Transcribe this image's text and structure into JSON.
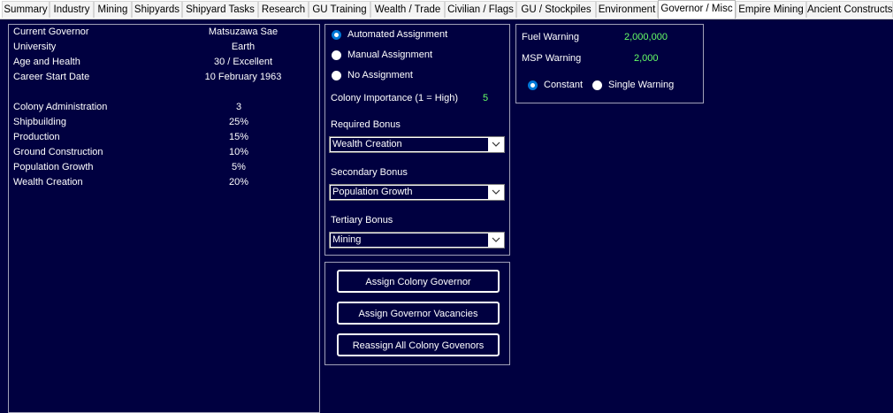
{
  "tabs": [
    {
      "label": "Summary"
    },
    {
      "label": "Industry"
    },
    {
      "label": "Mining"
    },
    {
      "label": "Shipyards"
    },
    {
      "label": "Shipyard Tasks"
    },
    {
      "label": "Research"
    },
    {
      "label": "GU Training"
    },
    {
      "label": "Wealth / Trade"
    },
    {
      "label": "Civilian / Flags"
    },
    {
      "label": "GU / Stockpiles"
    },
    {
      "label": "Environment"
    },
    {
      "label": "Governor / Misc"
    },
    {
      "label": "Empire Mining"
    },
    {
      "label": "Ancient Constructs"
    }
  ],
  "active_tab": "Governor / Misc",
  "governor": {
    "rows": [
      {
        "label": "Current Governor",
        "value": "Matsuzawa Sae"
      },
      {
        "label": "University",
        "value": "Earth"
      },
      {
        "label": "Age and Health",
        "value": "30 / Excellent"
      },
      {
        "label": "Career Start Date",
        "value": "10 February 1963"
      }
    ],
    "bonuses": [
      {
        "label": "Colony Administration",
        "value": "3"
      },
      {
        "label": "Shipbuilding",
        "value": "25%"
      },
      {
        "label": "Production",
        "value": "15%"
      },
      {
        "label": "Ground Construction",
        "value": "10%"
      },
      {
        "label": "Population Growth",
        "value": "5%"
      },
      {
        "label": "Wealth Creation",
        "value": "20%"
      }
    ]
  },
  "assignment": {
    "options": [
      {
        "label": "Automated Assignment",
        "selected": true
      },
      {
        "label": "Manual Assignment",
        "selected": false
      },
      {
        "label": "No Assignment",
        "selected": false
      }
    ],
    "importance_label": "Colony Importance (1 = High)",
    "importance_value": "5",
    "required_label": "Required Bonus",
    "required_value": "Wealth Creation",
    "secondary_label": "Secondary Bonus",
    "secondary_value": "Population Growth",
    "tertiary_label": "Tertiary Bonus",
    "tertiary_value": "Mining"
  },
  "buttons": {
    "assign_colony_governor": "Assign Colony Governor",
    "assign_governor_vacancies": "Assign Governor Vacancies",
    "reassign_all": "Reassign All Colony Govenors"
  },
  "warnings": {
    "fuel_label": "Fuel Warning",
    "fuel_value": "2,000,000",
    "msp_label": "MSP Warning",
    "msp_value": "2,000",
    "mode_options": [
      {
        "label": "Constant",
        "selected": true
      },
      {
        "label": "Single Warning",
        "selected": false
      }
    ]
  },
  "colors": {
    "background": "#000040",
    "value_green": "#66ff66",
    "radio_selected": "#0078d7"
  },
  "icons": {
    "combo_arrow": "chevron-down-icon"
  }
}
